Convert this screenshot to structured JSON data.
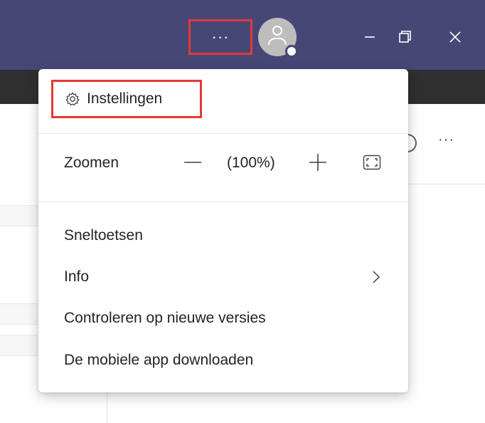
{
  "titlebar": {
    "more_label": "···",
    "icons": [
      "more-icon",
      "avatar",
      "minimize-icon",
      "maximize-icon",
      "close-icon"
    ]
  },
  "background": {
    "more_label": "···",
    "info_label": "i"
  },
  "menu": {
    "settings_label": "Instellingen",
    "zoom": {
      "label": "Zoomen",
      "level": "(100%)"
    },
    "items": [
      {
        "label": "Sneltoetsen"
      },
      {
        "label": "Info"
      },
      {
        "label": "Controleren op nieuwe versies"
      },
      {
        "label": "De mobiele app downloaden"
      }
    ]
  },
  "colors": {
    "titlebar": "#464775",
    "highlight": "#e53935",
    "menu_bg": "#ffffff"
  }
}
